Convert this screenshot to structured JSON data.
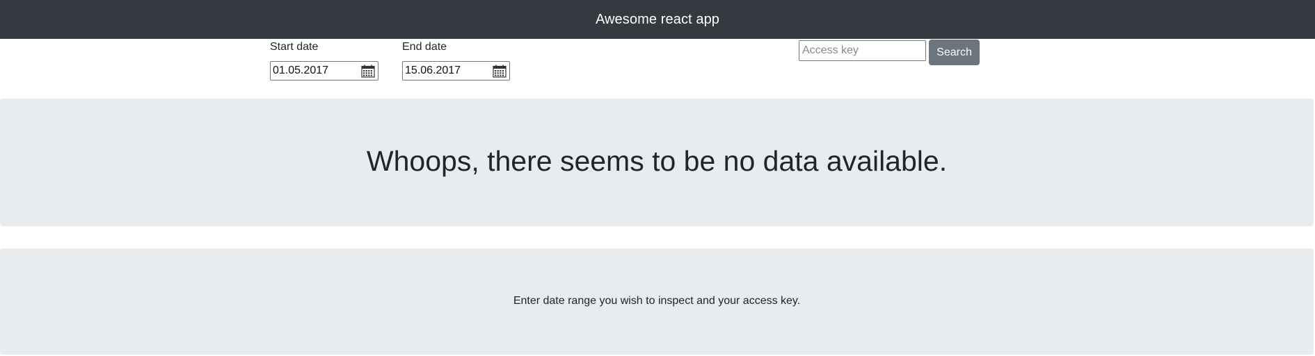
{
  "app": {
    "title": "Awesome react app"
  },
  "filters": {
    "start_date_label": "Start date",
    "start_date_value": "01.05.2017",
    "end_date_label": "End date",
    "end_date_value": "15.06.2017",
    "access_key_placeholder": "Access key",
    "access_key_value": "",
    "search_label": "Search"
  },
  "messages": {
    "no_data": "Whoops, there seems to be no data available.",
    "instructions": "Enter date range you wish to inspect and your access key."
  },
  "icons": {
    "date_picker": "calendar-icon"
  },
  "colors": {
    "navbar": "#343a40",
    "panel": "#e9ecef",
    "button": "#6c757d"
  }
}
